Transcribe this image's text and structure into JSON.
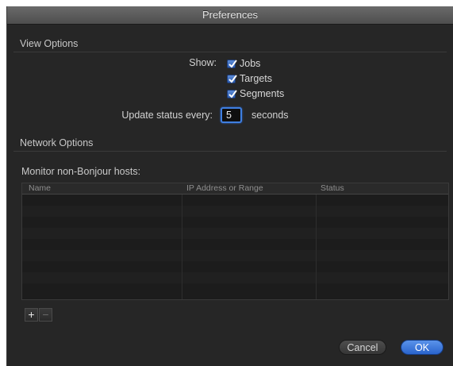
{
  "window": {
    "title": "Preferences"
  },
  "view_options": {
    "header": "View Options",
    "show_label": "Show:",
    "checkboxes": [
      {
        "label": "Jobs",
        "checked": true
      },
      {
        "label": "Targets",
        "checked": true
      },
      {
        "label": "Segments",
        "checked": true
      }
    ],
    "update_label": "Update status every:",
    "update_value": "5",
    "update_unit": "seconds"
  },
  "network_options": {
    "header": "Network Options",
    "monitor_label": "Monitor non-Bonjour hosts:",
    "table": {
      "columns": [
        "Name",
        "IP Address or Range",
        "Status"
      ],
      "rows": []
    },
    "add_symbol": "+",
    "remove_symbol": "−"
  },
  "buttons": {
    "cancel": "Cancel",
    "ok": "OK"
  },
  "colors": {
    "accent": "#3f7fe0",
    "background": "#262626"
  }
}
